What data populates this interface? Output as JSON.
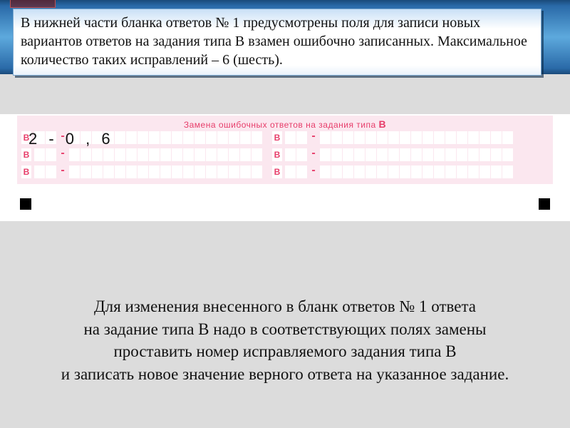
{
  "card_text": "В нижней части бланка ответов № 1 предусмотрены поля для записи новых вариантов ответов на задания типа В взамен ошибочно записанных. Максимальное количество таких исправлений – 6 (шесть).",
  "form": {
    "title_prefix": "Замена ошибочных ответов на задания типа",
    "title_letter": "В",
    "letter": "В",
    "num_cells_small": 2,
    "num_cells_large": 17,
    "sample": "2   - 0 , 6"
  },
  "lower_lines": [
    "Для изменения внесенного в бланк ответов № 1 ответа",
    "на задание типа В надо в соответствующих полях замены",
    "проставить номер исправляемого задания типа В",
    "и записать новое значение верного ответа на указанное задание."
  ]
}
